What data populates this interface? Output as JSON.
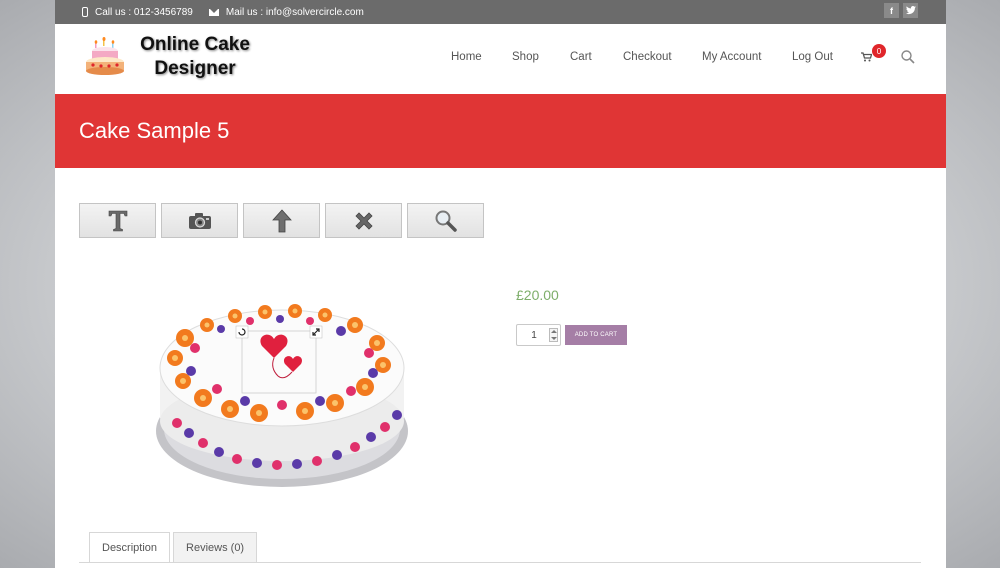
{
  "topbar": {
    "phone": "Call us : 012-3456789",
    "mail": "Mail us : info@solvercircle.com",
    "social": [
      "facebook-icon",
      "twitter-icon"
    ]
  },
  "header": {
    "logo_text": "Online Cake Designer",
    "nav": [
      "Home",
      "Shop",
      "Cart",
      "Checkout",
      "My Account",
      "Log Out"
    ],
    "cart_count": "0"
  },
  "banner": {
    "title": "Cake Sample 5"
  },
  "toolbar": {
    "buttons": [
      "text-tool-icon",
      "camera-icon",
      "upload-arrow-icon",
      "delete-x-icon",
      "zoom-icon"
    ]
  },
  "product": {
    "price": "£20.00",
    "quantity": "1",
    "add_to_cart": "ADD TO CART"
  },
  "tabs": [
    "Description",
    "Reviews (0)"
  ],
  "colors": {
    "banner": "#e03535",
    "price": "#7eae6a",
    "add_to_cart": "#a57ea6",
    "topbar": "#6b6b6b",
    "badge": "#e0262b"
  }
}
